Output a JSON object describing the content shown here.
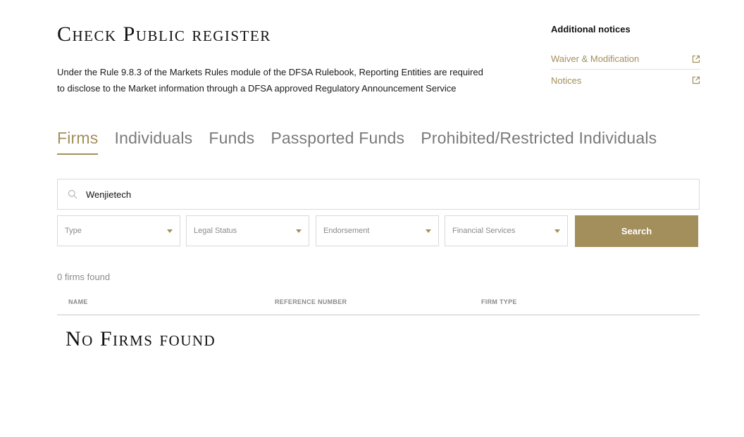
{
  "header": {
    "title": "Check Public register",
    "intro": "Under the Rule 9.8.3 of the Markets Rules module of the DFSA Rulebook, Reporting Entities are required to disclose to the Market information through a DFSA approved Regulatory Announcement Service"
  },
  "notices": {
    "heading": "Additional notices",
    "links": [
      {
        "label": "Waiver & Modification",
        "icon": "external-link-icon"
      },
      {
        "label": "Notices",
        "icon": "external-link-icon"
      }
    ]
  },
  "tabs": [
    {
      "label": "Firms",
      "active": true
    },
    {
      "label": "Individuals",
      "active": false
    },
    {
      "label": "Funds",
      "active": false
    },
    {
      "label": "Passported Funds",
      "active": false
    },
    {
      "label": "Prohibited/Restricted Individuals",
      "active": false
    }
  ],
  "search": {
    "value": "Wenjietech",
    "icon": "search-icon"
  },
  "filters": [
    {
      "label": "Type"
    },
    {
      "label": "Legal Status"
    },
    {
      "label": "Endorsement"
    },
    {
      "label": "Financial Services"
    }
  ],
  "search_button": "Search",
  "results": {
    "count_text": "0 firms found",
    "columns": [
      "NAME",
      "REFERENCE NUMBER",
      "FIRM TYPE"
    ],
    "empty_message": "No Firms found"
  },
  "colors": {
    "accent": "#a38f5c",
    "muted_text": "#8a8a8a",
    "border": "#d9d9d9"
  }
}
